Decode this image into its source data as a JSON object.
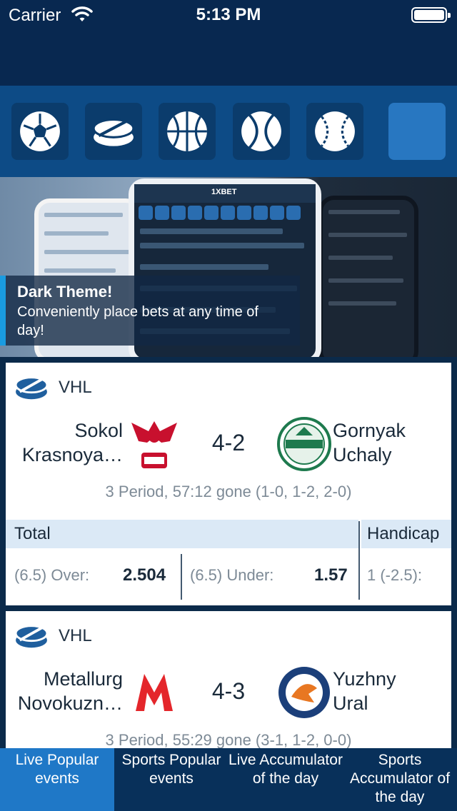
{
  "status_bar": {
    "carrier": "Carrier",
    "time": "5:13 PM"
  },
  "sports": [
    {
      "icon": "soccer-ball-icon",
      "selected": false
    },
    {
      "icon": "hockey-puck-icon",
      "selected": false
    },
    {
      "icon": "basketball-icon",
      "selected": false
    },
    {
      "icon": "tennis-ball-icon",
      "selected": false
    },
    {
      "icon": "baseball-icon",
      "selected": false
    },
    {
      "icon": "",
      "selected": true
    }
  ],
  "banner": {
    "title": "Dark Theme!",
    "text": "Conveniently place bets at any time of day!"
  },
  "matches": [
    {
      "league": "VHL",
      "team_home": [
        "Sokol",
        "Krasnoya…"
      ],
      "team_away": [
        "Gornyak",
        "Uchaly"
      ],
      "score": "4-2",
      "period": "3  Period, 57:12 gone (1-0, 1-2, 2-0)",
      "market_total": "Total",
      "market_handicap": "Handicap",
      "over_label": "(6.5) Over:",
      "over_value": "2.504",
      "under_label": "(6.5) Under:",
      "under_value": "1.57",
      "handicap_label": "1 (-2.5):"
    },
    {
      "league": "VHL",
      "team_home": [
        "Metallurg",
        "Novokuzn…"
      ],
      "team_away": [
        "Yuzhny",
        "Ural"
      ],
      "score": "4-3",
      "period": "3  Period, 55:29 gone (3-1, 1-2, 0-0)"
    }
  ],
  "tabs": [
    {
      "label": "Live Popular events",
      "active": true
    },
    {
      "label": "Sports Popular events",
      "active": false
    },
    {
      "label": "Live Accumulator of the day",
      "active": false
    },
    {
      "label": "Sports Accumulator of the day",
      "active": false
    }
  ],
  "colors": {
    "header": "#082850",
    "sports_bar": "#0d4b86",
    "active_tab": "#1f78c7",
    "accent": "#1a9be0"
  }
}
